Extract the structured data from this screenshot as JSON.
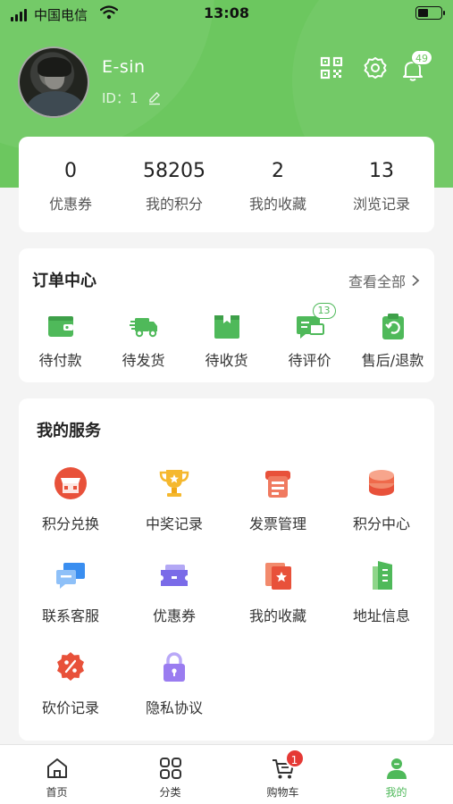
{
  "status_bar": {
    "carrier": "中国电信",
    "time": "13:08"
  },
  "profile": {
    "username": "E-sin",
    "id_label": "ID：1"
  },
  "header": {
    "notification_count": "49"
  },
  "stats": [
    {
      "value": "0",
      "label": "优惠券"
    },
    {
      "value": "58205",
      "label": "我的积分"
    },
    {
      "value": "2",
      "label": "我的收藏"
    },
    {
      "value": "13",
      "label": "浏览记录"
    }
  ],
  "orders": {
    "title": "订单中心",
    "view_all": "查看全部",
    "items": [
      {
        "label": "待付款",
        "icon": "wallet-icon"
      },
      {
        "label": "待发货",
        "icon": "truck-icon"
      },
      {
        "label": "待收货",
        "icon": "package-icon"
      },
      {
        "label": "待评价",
        "icon": "review-icon",
        "badge": "13"
      },
      {
        "label": "售后/退款",
        "icon": "refund-icon"
      }
    ]
  },
  "services": {
    "title": "我的服务",
    "items": [
      {
        "label": "积分兑换",
        "icon": "shop-icon",
        "color": "#e8513a"
      },
      {
        "label": "中奖记录",
        "icon": "trophy-icon",
        "color": "#f5b82e"
      },
      {
        "label": "发票管理",
        "icon": "invoice-icon",
        "color": "#e8513a"
      },
      {
        "label": "积分中心",
        "icon": "coins-icon",
        "color": "#ef6a4b"
      },
      {
        "label": "联系客服",
        "icon": "chat-icon",
        "color": "#3a8ef0"
      },
      {
        "label": "优惠券",
        "icon": "coupon-icon",
        "color": "#7a6be8"
      },
      {
        "label": "我的收藏",
        "icon": "favorite-icon",
        "color": "#e8513a"
      },
      {
        "label": "地址信息",
        "icon": "building-icon",
        "color": "#4fb95a"
      },
      {
        "label": "砍价记录",
        "icon": "discount-icon",
        "color": "#e8513a"
      },
      {
        "label": "隐私协议",
        "icon": "lock-icon",
        "color": "#9a7cf0"
      }
    ]
  },
  "tabbar": {
    "items": [
      {
        "label": "首页",
        "icon": "home-icon"
      },
      {
        "label": "分类",
        "icon": "grid-icon"
      },
      {
        "label": "购物车",
        "icon": "cart-icon",
        "badge": "1"
      },
      {
        "label": "我的",
        "icon": "profile-icon",
        "active": true
      }
    ]
  },
  "colors": {
    "brand": "#6cc75f",
    "accent": "#4fb95a",
    "badge_red": "#e53935"
  }
}
